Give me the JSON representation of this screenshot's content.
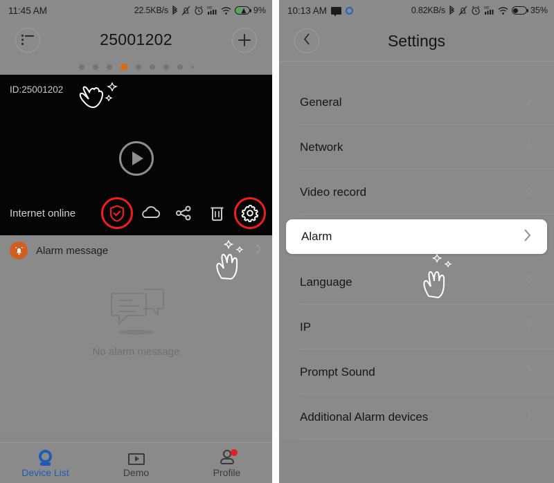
{
  "left_phone": {
    "status_bar": {
      "time": "11:45 AM",
      "network_speed": "22.5KB/s",
      "battery_percent": "9%",
      "icons": [
        "bluetooth-icon",
        "mute-bell-icon",
        "alarm-clock-icon",
        "hd-signal-icon",
        "wifi-icon",
        "battery-charging-icon"
      ]
    },
    "app_bar": {
      "title": "25001202",
      "left_icon": "list-menu-icon",
      "right_icon": "plus-icon"
    },
    "pager": {
      "total_dots": 8,
      "active_index": 3,
      "has_mini_dot": true,
      "active_color": "#d96b14"
    },
    "video": {
      "id_label": "ID:25001202",
      "play_icon": "play-circle-icon",
      "status_text": "Internet online",
      "toolbar_icons": [
        {
          "name": "shield-check-icon",
          "highlighted": true,
          "color": "#ef1d1d"
        },
        {
          "name": "cloud-icon",
          "highlighted": false
        },
        {
          "name": "share-icon",
          "highlighted": false
        },
        {
          "name": "trash-icon",
          "highlighted": false
        },
        {
          "name": "gear-icon",
          "highlighted": true
        }
      ],
      "highlight_color": "#ef1d1d"
    },
    "alarm_row": {
      "icon": "alarm-bell-icon",
      "icon_color": "#cf5f1f",
      "label": "Alarm message",
      "chevron": "chevron-right-icon"
    },
    "empty_state": {
      "icon": "chat-bubbles-icon",
      "text": "No alarm message"
    },
    "bottom_nav": {
      "items": [
        {
          "label": "Device List",
          "icon": "camera-icon",
          "active": true,
          "badge": false
        },
        {
          "label": "Demo",
          "icon": "play-box-icon",
          "active": false,
          "badge": false
        },
        {
          "label": "Profile",
          "icon": "person-icon",
          "active": false,
          "badge": true
        }
      ],
      "active_color": "#1f5bb5",
      "badge_color": "#e02020"
    }
  },
  "right_phone": {
    "status_bar": {
      "time": "10:13 AM",
      "network_speed": "0.82KB/s",
      "battery_percent": "35%",
      "left_icons": [
        "message-icon",
        "circle-sync-icon"
      ],
      "icons": [
        "bluetooth-icon",
        "mute-bell-icon",
        "alarm-clock-icon",
        "hd-signal-icon",
        "wifi-icon",
        "battery-icon"
      ]
    },
    "app_bar": {
      "title": "Settings",
      "back_icon": "chevron-left-icon"
    },
    "settings_items": [
      {
        "label": "General",
        "highlighted": false
      },
      {
        "label": "Network",
        "highlighted": false
      },
      {
        "label": "Video record",
        "highlighted": false
      },
      {
        "label": "Alarm",
        "highlighted": true
      },
      {
        "label": "Language",
        "highlighted": false
      },
      {
        "label": "IP",
        "highlighted": false
      },
      {
        "label": "Prompt Sound",
        "highlighted": false
      },
      {
        "label": "Additional Alarm devices",
        "highlighted": false
      }
    ],
    "chevron_icon": "chevron-right-icon"
  }
}
